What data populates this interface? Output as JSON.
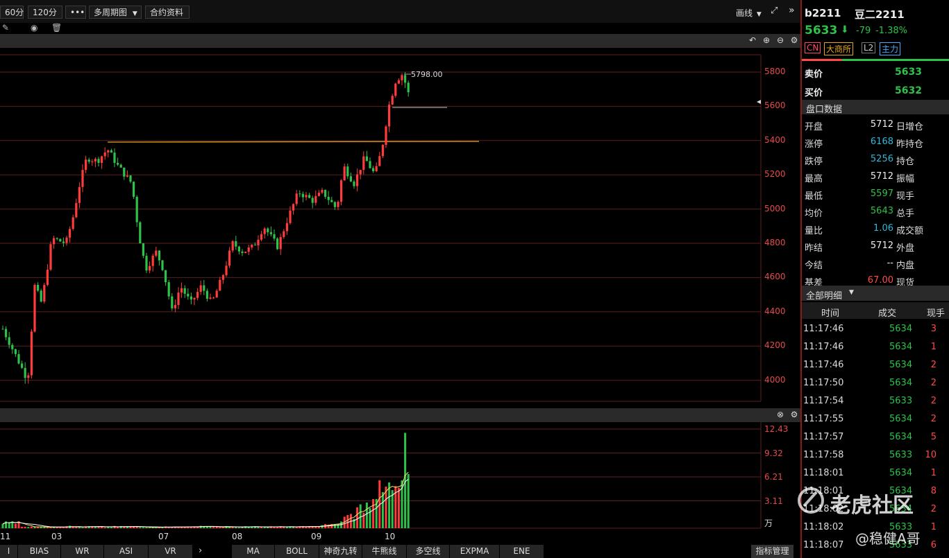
{
  "toolbar": {
    "period_60": "60分",
    "period_120": "120分",
    "more": "•••",
    "multi_period": "多周期图",
    "contract_info": "合约资料",
    "draw_line": "画线"
  },
  "main_chart": {
    "y_labels": [
      "5800",
      "5600",
      "5400",
      "5200",
      "5000",
      "4800",
      "4600",
      "4400",
      "4200",
      "4000"
    ],
    "peak_label": "5798.00"
  },
  "volume_chart": {
    "y_labels": [
      "12.43",
      "9.32",
      "6.21",
      "3.11"
    ],
    "unit": "万",
    "x_labels": [
      "11",
      "03",
      "07",
      "08",
      "09",
      "10"
    ]
  },
  "indicator_tabs": [
    "I",
    "BIAS",
    "WR",
    "ASI",
    "VR"
  ],
  "overlay_tabs": [
    "MA",
    "BOLL",
    "神奇九转",
    "牛熊线",
    "多空线",
    "EXPMA",
    "ENE"
  ],
  "indicator_manage": "指标管理",
  "quote": {
    "code": "b2211",
    "name": "豆二2211",
    "price": "5633",
    "change": "-79",
    "change_pct": "-1.38%",
    "badges": [
      "CN",
      "大商所",
      "L2",
      "主力"
    ],
    "ask_label": "卖价",
    "ask": "5633",
    "bid_label": "买价",
    "bid": "5632",
    "section_title": "盘口数据",
    "rows": [
      {
        "label": "开盘",
        "value": "5712",
        "label2": "日增仓"
      },
      {
        "label": "涨停",
        "value": "6168",
        "label2": "昨持仓"
      },
      {
        "label": "跌停",
        "value": "5256",
        "label2": "持仓"
      },
      {
        "label": "最高",
        "value": "5712",
        "label2": "振幅"
      },
      {
        "label": "最低",
        "value": "5597",
        "label2": "现手"
      },
      {
        "label": "均价",
        "value": "5643",
        "label2": "总手"
      },
      {
        "label": "量比",
        "value": "1.06",
        "label2": "成交额"
      },
      {
        "label": "昨结",
        "value": "5712",
        "label2": "外盘"
      },
      {
        "label": "今结",
        "value": "--",
        "label2": "内盘"
      },
      {
        "label": "基差",
        "value": "67.00",
        "label2": "现货"
      }
    ]
  },
  "trades": {
    "title": "全部明细",
    "headers": [
      "时间",
      "成交",
      "现手"
    ],
    "rows": [
      {
        "time": "11:17:46",
        "price": "5634",
        "vol": "3"
      },
      {
        "time": "11:17:46",
        "price": "5634",
        "vol": "1"
      },
      {
        "time": "11:17:46",
        "price": "5634",
        "vol": "2"
      },
      {
        "time": "11:17:50",
        "price": "5634",
        "vol": "2"
      },
      {
        "time": "11:17:54",
        "price": "5633",
        "vol": "2"
      },
      {
        "time": "11:17:55",
        "price": "5634",
        "vol": "2"
      },
      {
        "time": "11:17:57",
        "price": "5634",
        "vol": "5"
      },
      {
        "time": "11:17:58",
        "price": "5633",
        "vol": "10"
      },
      {
        "time": "11:18:01",
        "price": "5634",
        "vol": "1"
      },
      {
        "time": "11:18:01",
        "price": "5634",
        "vol": "8"
      },
      {
        "time": "11:18:02",
        "price": "5634",
        "vol": "2"
      },
      {
        "time": "11:18:02",
        "price": "5633",
        "vol": "1"
      },
      {
        "time": "11:18:07",
        "price": "5633",
        "vol": "6"
      }
    ]
  },
  "watermark": {
    "logo_text": "老虎社区",
    "author": "@稳健A哥"
  }
}
